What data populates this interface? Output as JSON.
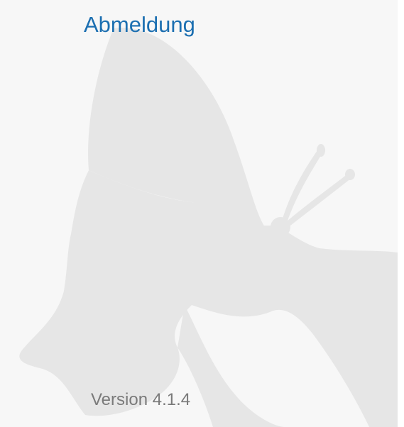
{
  "menu": {
    "logout_label": "Abmeldung"
  },
  "footer": {
    "version_text": "Version 4.1.4"
  },
  "background": {
    "icon": "butterfly-watermark-icon",
    "color": "#e6e6e6",
    "panel_color": "#f7f7f7"
  },
  "colors": {
    "link": "#1c6fb1",
    "version_text": "#7a7a7a"
  }
}
